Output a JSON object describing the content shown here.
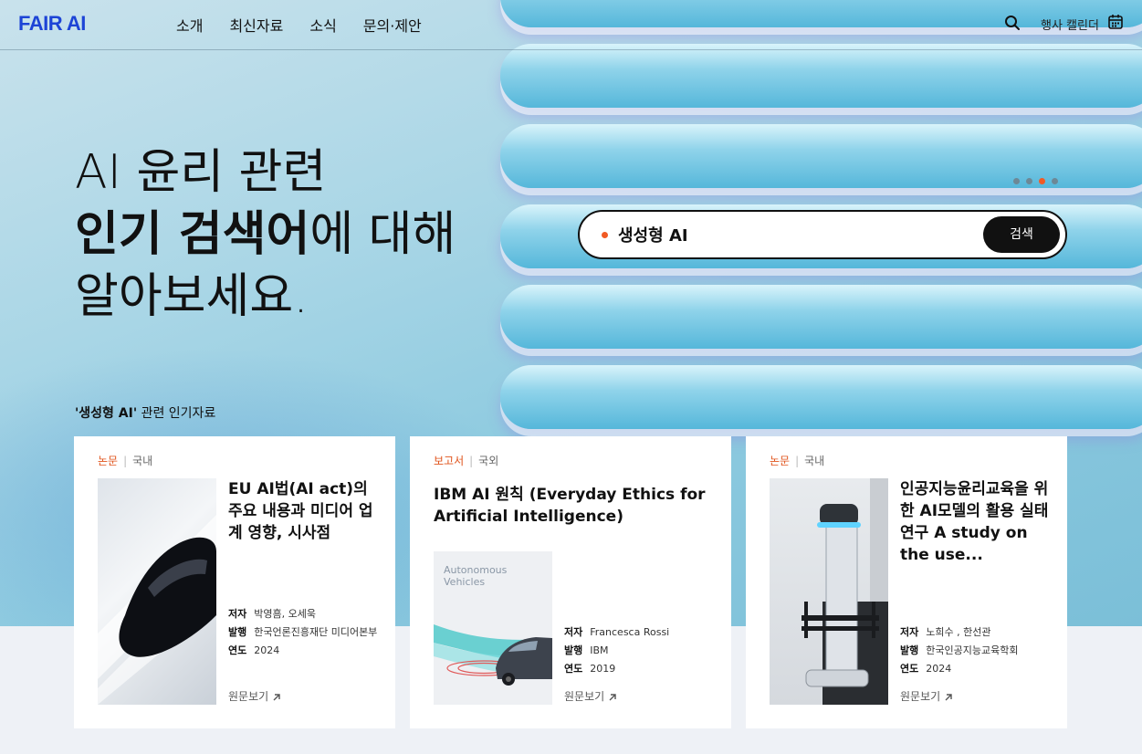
{
  "header": {
    "logo": "FAIR AI",
    "nav": [
      "소개",
      "최신자료",
      "소식",
      "문의·제안"
    ],
    "calendar_label": "행사 캘린더"
  },
  "hero": {
    "line1": "AI 윤리 관련",
    "line2_bold": "인기 검색어",
    "line2_rest": "에 대해",
    "line3": "알아보세요.",
    "carousel": {
      "total": 4,
      "active_index": 3
    },
    "search_value": "생성형 AI",
    "search_button": "검색",
    "section_quote": "'생성형 AI'",
    "section_rest": " 관련 인기자료"
  },
  "cards": [
    {
      "type": "논문",
      "region": "국내",
      "title": "EU AI법(AI act)의 주요 내용과 미디어 업계 영향, 시사점",
      "author_label": "저자",
      "author": "박영흠, 오세욱",
      "publisher_label": "발행",
      "publisher": "한국언론진흥재단 미디어본부",
      "year_label": "연도",
      "year": "2024",
      "link": "원문보기"
    },
    {
      "type": "보고서",
      "region": "국외",
      "title": "IBM AI 원칙 (Everyday Ethics for Artificial Intelligence)",
      "thumb_text": "Autonomous Vehicles",
      "author_label": "저자",
      "author": "Francesca Rossi",
      "publisher_label": "발행",
      "publisher": "IBM",
      "year_label": "연도",
      "year": "2019",
      "link": "원문보기"
    },
    {
      "type": "논문",
      "region": "국내",
      "title": "인공지능윤리교육을 위한 AI모델의 활용 실태 연구 A study on the use...",
      "author_label": "저자",
      "author": "노희수 , 한선관",
      "publisher_label": "발행",
      "publisher": "한국인공지능교육학회",
      "year_label": "연도",
      "year": "2024",
      "link": "원문보기"
    }
  ],
  "colors": {
    "accent": "#f15a24",
    "brand": "#1d44d6"
  }
}
